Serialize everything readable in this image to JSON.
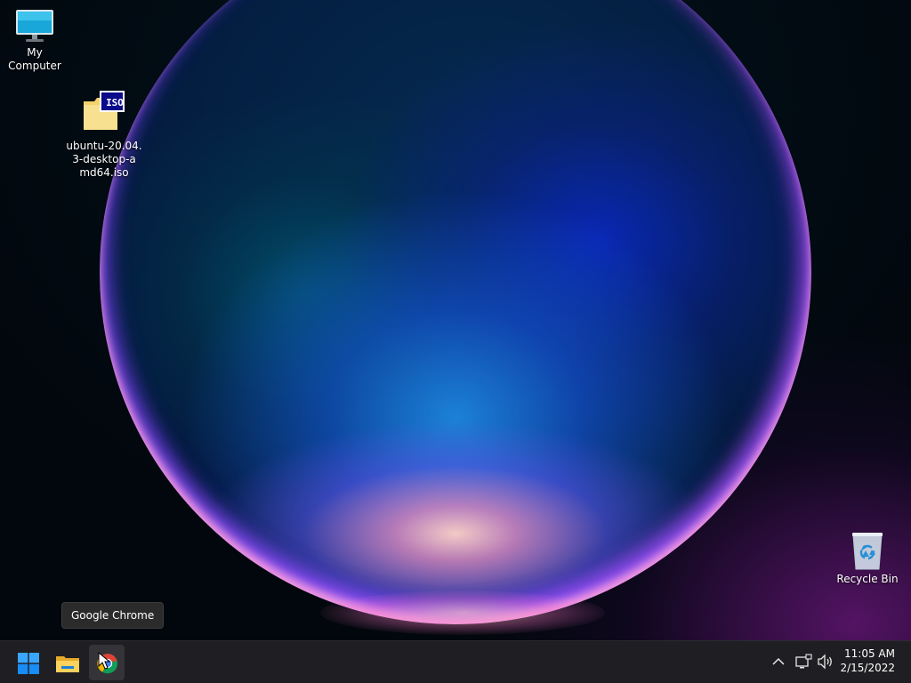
{
  "desktop": {
    "icons": [
      {
        "label": "My Computer",
        "icon": "monitor-icon"
      },
      {
        "label_lines": [
          "ubuntu-20.04.",
          "3-desktop-a",
          "md64.iso"
        ],
        "icon": "iso-file-icon",
        "badge": "ISO"
      },
      {
        "label": "Recycle Bin",
        "icon": "recycle-bin-icon"
      }
    ]
  },
  "tooltip": {
    "text": "Google Chrome"
  },
  "taskbar": {
    "buttons": [
      {
        "name": "Start",
        "icon": "windows-logo-icon"
      },
      {
        "name": "File Explorer",
        "icon": "folder-icon"
      },
      {
        "name": "Google Chrome",
        "icon": "chrome-icon",
        "active": true
      }
    ],
    "tray": {
      "chevron": "chevron-up-icon",
      "network": "network-icon",
      "volume": "volume-icon"
    },
    "clock": {
      "time": "11:05 AM",
      "date": "2/15/2022"
    }
  },
  "colors": {
    "taskbar": "#1f1f23",
    "accent": "#0a84ff",
    "tooltip": "#2b2b2b"
  }
}
